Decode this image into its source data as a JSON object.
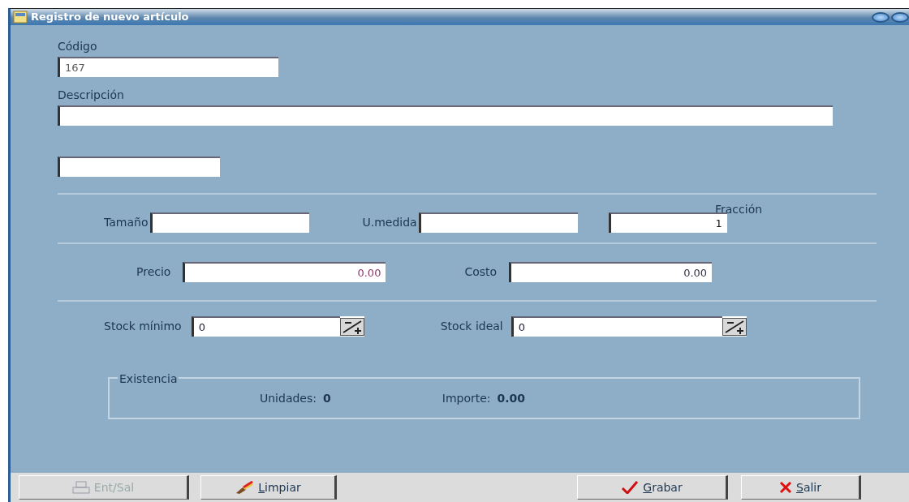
{
  "window": {
    "title": "Registro de nuevo artículo"
  },
  "codigo": {
    "label": "Código",
    "value": "167"
  },
  "descripcion": {
    "label": "Descripción"
  },
  "tamano": {
    "label": "Tamaño"
  },
  "unidad_medida": {
    "label": "U.medida"
  },
  "fraccion": {
    "label": "Fracción",
    "value": "1"
  },
  "precio": {
    "label": "Precio",
    "value": "0.00"
  },
  "costo": {
    "label": "Costo",
    "value": "0.00"
  },
  "stock_minimo": {
    "label": "Stock mínimo",
    "value": "0"
  },
  "stock_ideal": {
    "label": "Stock ideal",
    "value": "0"
  },
  "existencia": {
    "title": "Existencia",
    "unidades_label": "Unidades:",
    "unidades": "0",
    "importe_label": "Importe:",
    "importe": "0.00"
  },
  "buttons": [
    {
      "kind": "print",
      "label": "Ent/Sal",
      "disabled": true,
      "underline_first": false
    },
    {
      "kind": "clear",
      "label": "Limpiar",
      "disabled": false,
      "underline_first": true
    },
    {
      "kind": "save",
      "label": "Grabar",
      "disabled": false,
      "underline_first": true
    },
    {
      "kind": "exit",
      "label": "Salir",
      "disabled": false,
      "underline_first": true
    }
  ]
}
